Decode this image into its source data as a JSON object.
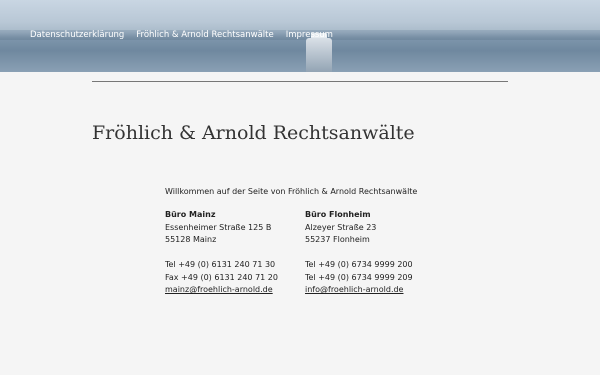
{
  "nav": {
    "items": [
      "Datenschutzerklärung",
      "Fröhlich & Arnold Rechtsanwälte",
      "Impressum"
    ]
  },
  "page": {
    "title": "Fröhlich & Arnold Rechtsanwälte",
    "welcome": "Willkommen auf der Seite von Fröhlich & Arnold Rechtsanwälte"
  },
  "offices": {
    "mainz": {
      "name": "Büro Mainz",
      "street": "Essenheimer Straße 125 B",
      "city": "55128 Mainz",
      "tel": "Tel +49 (0) 6131 240 71 30",
      "fax": "Fax +49 (0) 6131 240 71 20",
      "email": "mainz@froehlich-arnold.de"
    },
    "flonheim": {
      "name": "Büro Flonheim",
      "street": "Alzeyer Straße 23",
      "city": "55237 Flonheim",
      "tel": "Tel +49 (0) 6734 9999 200",
      "fax": "Tel +49 (0) 6734 9999 209",
      "email": "info@froehlich-arnold.de"
    }
  },
  "colors": {
    "background": "#f5f5f5",
    "nav_text": "#ffffff",
    "title_text": "#333333"
  }
}
